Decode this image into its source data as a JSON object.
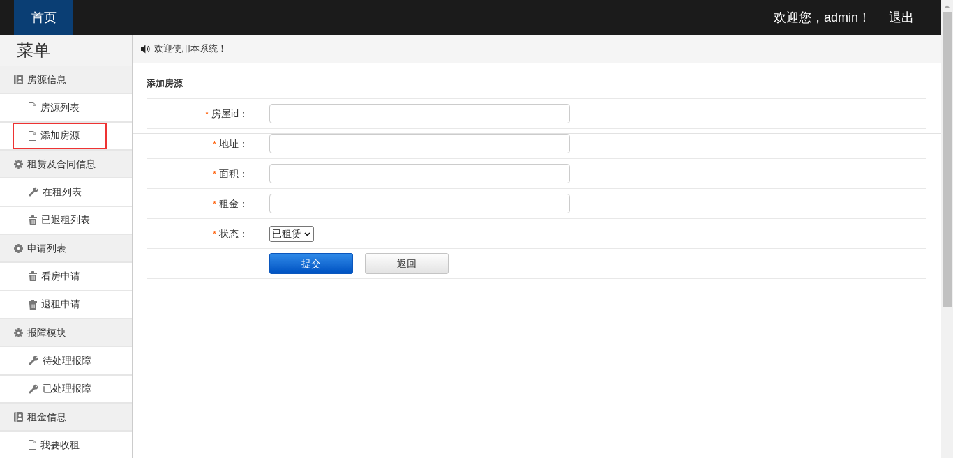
{
  "top_bar": {
    "tabs": [
      {
        "label": "首页",
        "selected": true
      }
    ],
    "welcome": "欢迎您，admin！",
    "logout": "退出"
  },
  "sidebar": {
    "title": "菜单",
    "groups": [
      {
        "label": "房源信息",
        "kind": "card",
        "children": [
          {
            "label": "房源列表",
            "kind": "page",
            "highlighted": false
          },
          {
            "label": "添加房源",
            "kind": "page",
            "highlighted": true
          }
        ]
      },
      {
        "label": "租赁及合同信息",
        "kind": "gear",
        "children": [
          {
            "label": "在租列表",
            "kind": "tool",
            "highlighted": false
          },
          {
            "label": "已退租列表",
            "kind": "trash",
            "highlighted": false
          }
        ]
      },
      {
        "label": "申请列表",
        "kind": "gear",
        "children": [
          {
            "label": "看房申请",
            "kind": "trash",
            "highlighted": false
          },
          {
            "label": "退租申请",
            "kind": "trash",
            "highlighted": false
          }
        ]
      },
      {
        "label": "报障模块",
        "kind": "gear",
        "children": [
          {
            "label": "待处理报障",
            "kind": "tool",
            "highlighted": false
          },
          {
            "label": "已处理报障",
            "kind": "tool",
            "highlighted": false
          }
        ]
      },
      {
        "label": "租金信息",
        "kind": "card",
        "children": [
          {
            "label": "我要收租",
            "kind": "page",
            "highlighted": false
          }
        ]
      }
    ]
  },
  "notice": {
    "text": "欢迎使用本系统！"
  },
  "form": {
    "title": "添加房源",
    "fields": [
      {
        "marker": "*",
        "label": "房屋id：",
        "kind": "text"
      },
      {
        "marker": "*",
        "label": "地址：",
        "kind": "text"
      },
      {
        "marker": "*",
        "label": "面积：",
        "kind": "text"
      },
      {
        "marker": "*",
        "label": "租金：",
        "kind": "text"
      },
      {
        "marker": "*",
        "label": "状态：",
        "kind": "select",
        "value": "已租赁"
      }
    ],
    "buttons": [
      {
        "label": "提交",
        "kind": "primary"
      },
      {
        "label": "返回",
        "kind": "default"
      }
    ]
  }
}
